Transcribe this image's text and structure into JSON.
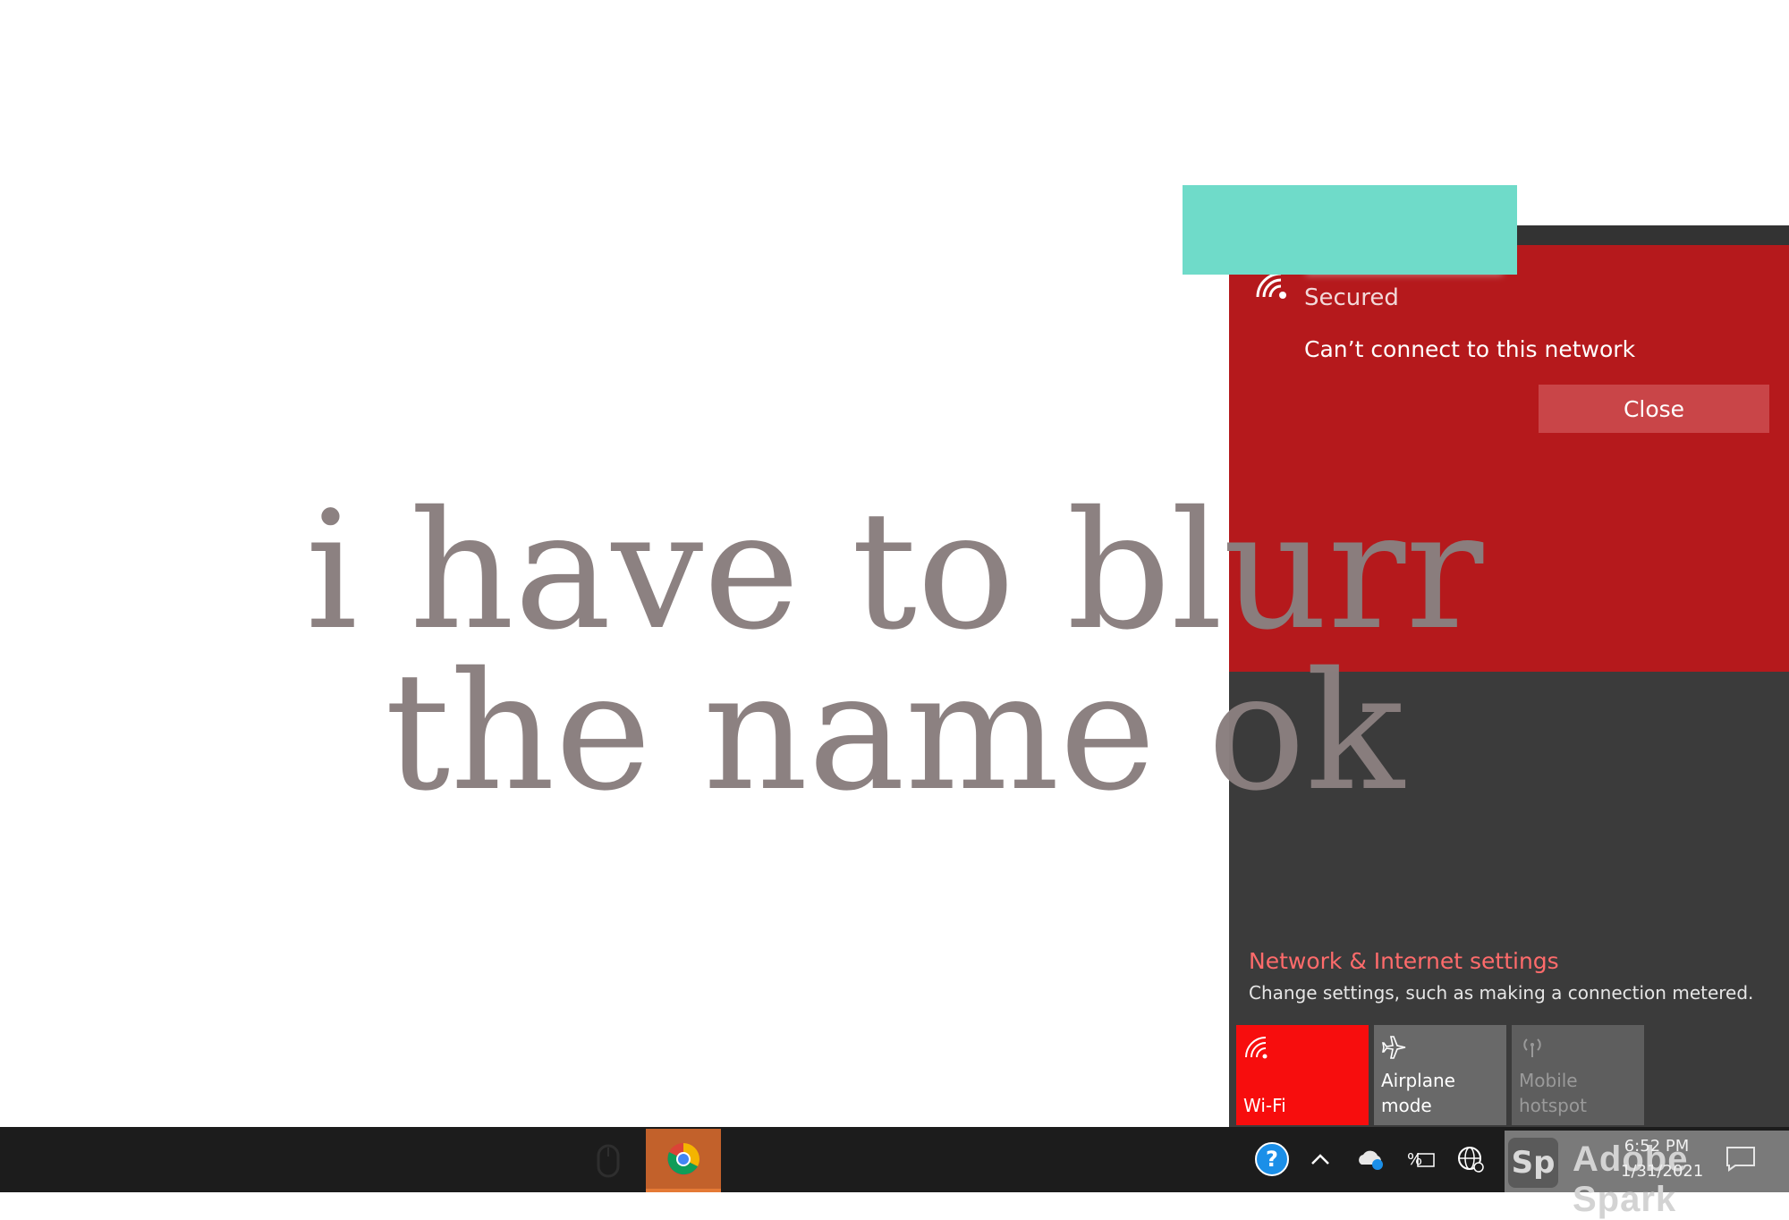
{
  "network_card": {
    "status": "Secured",
    "error_message": "Can’t connect to this network",
    "close_label": "Close"
  },
  "settings": {
    "link": "Network & Internet settings",
    "description": "Change settings, such as making a connection metered."
  },
  "quick_actions": [
    {
      "label": "Wi-Fi",
      "icon": "wifi-icon",
      "active": true
    },
    {
      "label": "Airplane mode",
      "icon": "airplane-icon",
      "active": false
    },
    {
      "label_lines": [
        "Mobile",
        "hotspot"
      ],
      "icon": "hotspot-icon",
      "active": false
    }
  ],
  "overlay": {
    "line1": "i have to blurr",
    "line2": "the name ok"
  },
  "taskbar": {
    "time": "6:52 PM",
    "date": "1/31/2021",
    "watermark_badge": "Sp",
    "watermark_text": "Adobe Spark"
  },
  "colors": {
    "error_red": "#b5191c",
    "wifi_tile": "#f70d0d",
    "settings_link": "#ff6b6b",
    "redaction": "#6fdbc9",
    "chrome_highlight": "#c2612b"
  }
}
